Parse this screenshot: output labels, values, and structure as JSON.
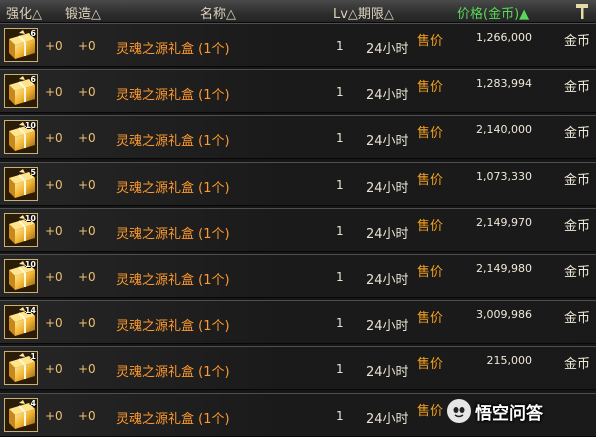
{
  "header": {
    "enhance": "强化△",
    "forge": "锻造△",
    "name": "名称△",
    "lv_period": "Lv△期限△",
    "price": "价格(金币)▲",
    "hammer_icon": "hammer-icon"
  },
  "colors": {
    "name": "#ff9a2e",
    "sell_label": "#f2a020",
    "active_sort": "#5ad75a",
    "header_text": "#ddd3bc"
  },
  "items": [
    {
      "qty": "6",
      "enhance": "+0",
      "forge": "+0",
      "name": "灵魂之源礼盒 (1个)",
      "lv": "1",
      "period": "24小时",
      "sell_label": "售价",
      "price": "1,266,000",
      "currency": "金币"
    },
    {
      "qty": "6",
      "enhance": "+0",
      "forge": "+0",
      "name": "灵魂之源礼盒 (1个)",
      "lv": "1",
      "period": "24小时",
      "sell_label": "售价",
      "price": "1,283,994",
      "currency": "金币"
    },
    {
      "qty": "10",
      "enhance": "+0",
      "forge": "+0",
      "name": "灵魂之源礼盒 (1个)",
      "lv": "1",
      "period": "24小时",
      "sell_label": "售价",
      "price": "2,140,000",
      "currency": "金币"
    },
    {
      "qty": "5",
      "enhance": "+0",
      "forge": "+0",
      "name": "灵魂之源礼盒 (1个)",
      "lv": "1",
      "period": "24小时",
      "sell_label": "售价",
      "price": "1,073,330",
      "currency": "金币"
    },
    {
      "qty": "10",
      "enhance": "+0",
      "forge": "+0",
      "name": "灵魂之源礼盒 (1个)",
      "lv": "1",
      "period": "24小时",
      "sell_label": "售价",
      "price": "2,149,970",
      "currency": "金币"
    },
    {
      "qty": "10",
      "enhance": "+0",
      "forge": "+0",
      "name": "灵魂之源礼盒 (1个)",
      "lv": "1",
      "period": "24小时",
      "sell_label": "售价",
      "price": "2,149,980",
      "currency": "金币"
    },
    {
      "qty": "14",
      "enhance": "+0",
      "forge": "+0",
      "name": "灵魂之源礼盒 (1个)",
      "lv": "1",
      "period": "24小时",
      "sell_label": "售价",
      "price": "3,009,986",
      "currency": "金币"
    },
    {
      "qty": "1",
      "enhance": "+0",
      "forge": "+0",
      "name": "灵魂之源礼盒 (1个)",
      "lv": "1",
      "period": "24小时",
      "sell_label": "售价",
      "price": "215,000",
      "currency": "金币"
    },
    {
      "qty": "4",
      "enhance": "+0",
      "forge": "+0",
      "name": "灵魂之源礼盒 (1个)",
      "lv": "1",
      "period": "24小时",
      "sell_label": "售价",
      "price": "",
      "currency": ""
    }
  ],
  "watermark": {
    "text": "悟空问答",
    "icon": "wukong-logo-icon"
  }
}
